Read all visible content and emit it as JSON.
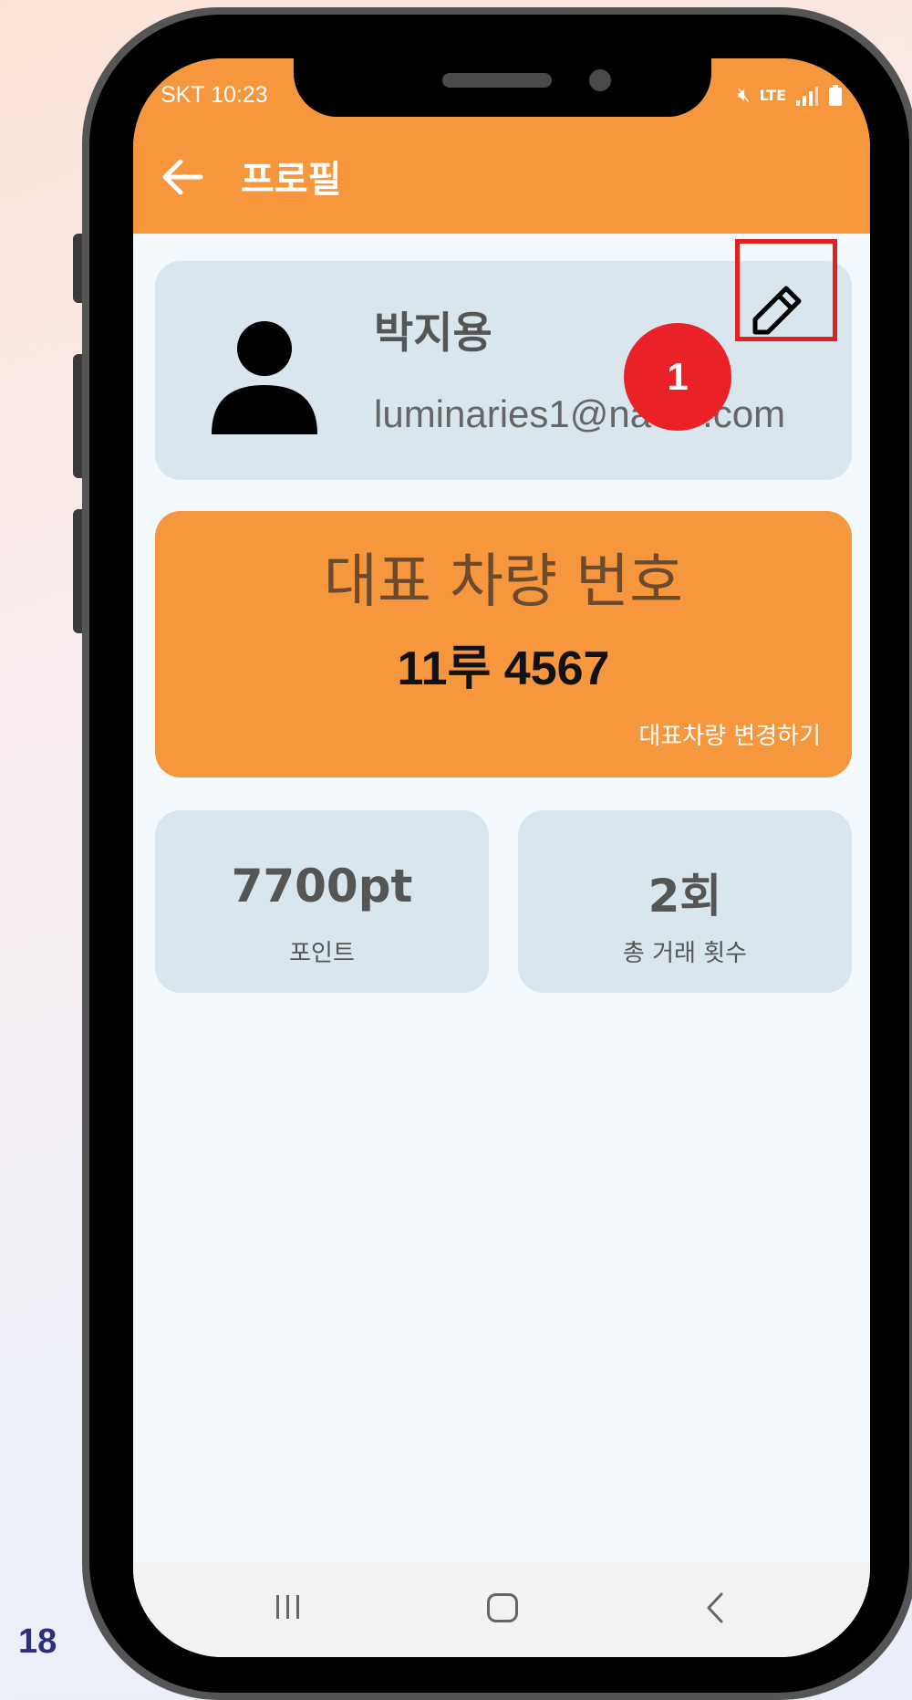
{
  "page_number": "18",
  "status_bar": {
    "carrier_time": "SKT 10:23",
    "icons": [
      "mute-icon",
      "lte-icon",
      "signal-icon",
      "battery-icon"
    ]
  },
  "app_bar": {
    "title": "프로필"
  },
  "profile": {
    "name": "박지용",
    "email": "luminaries1@naver.com"
  },
  "annotation": {
    "step": "1",
    "highlight_color": "#e52020"
  },
  "vehicle": {
    "label": "대표 차량 번호",
    "number": "11루 4567",
    "change_link": "대표차량 변경하기"
  },
  "stats": [
    {
      "value": "7700pt",
      "label": "포인트"
    },
    {
      "value": "2회",
      "label": "총 거래 횟수"
    }
  ],
  "colors": {
    "accent": "#f6963d",
    "card": "#d9e6ee",
    "screen_bg": "#f4f9fd"
  }
}
